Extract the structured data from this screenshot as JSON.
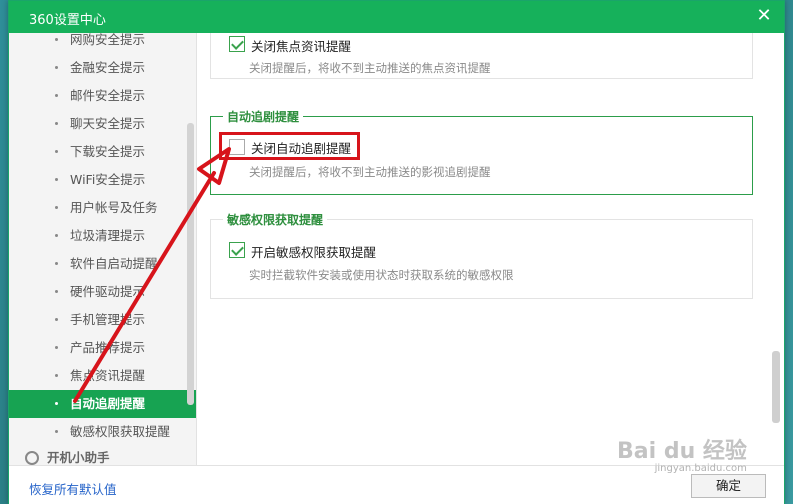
{
  "window": {
    "title": "360设置中心",
    "close_glyph": "✕"
  },
  "sidebar": {
    "items": [
      {
        "label": "网购安全提示"
      },
      {
        "label": "金融安全提示"
      },
      {
        "label": "邮件安全提示"
      },
      {
        "label": "聊天安全提示"
      },
      {
        "label": "下载安全提示"
      },
      {
        "label": "WiFi安全提示"
      },
      {
        "label": "用户帐号及任务"
      },
      {
        "label": "垃圾清理提示"
      },
      {
        "label": "软件自启动提醒"
      },
      {
        "label": "硬件驱动提示"
      },
      {
        "label": "手机管理提示"
      },
      {
        "label": "产品推荐提示"
      },
      {
        "label": "焦点资讯提醒"
      },
      {
        "label": "自动追剧提醒"
      },
      {
        "label": "敏感权限获取提醒"
      }
    ],
    "active_index": 13,
    "group_label": "开机小助手"
  },
  "sections": {
    "focus": {
      "checkbox_label": "关闭焦点资讯提醒",
      "checked": true,
      "description": "关闭提醒后，将收不到主动推送的焦点资讯提醒"
    },
    "auto_drama": {
      "title": "自动追剧提醒",
      "checkbox_label": "关闭自动追剧提醒",
      "checked": false,
      "description": "关闭提醒后，将收不到主动推送的影视追剧提醒"
    },
    "sensitive": {
      "title": "敏感权限获取提醒",
      "checkbox_label": "开启敏感权限获取提醒",
      "checked": true,
      "description": "实时拦截软件安装或使用状态时获取系统的敏感权限"
    }
  },
  "footer": {
    "restore_label": "恢复所有默认值",
    "ok_label": "确定"
  },
  "watermark": {
    "brand": "Bai du 经验",
    "url": "jingyan.baidu.com"
  },
  "colors": {
    "accent": "#16b15b",
    "active_item": "#17a352",
    "highlight_border": "#2c9d4a",
    "annotation_red": "#d7141b",
    "link": "#2563c9"
  }
}
